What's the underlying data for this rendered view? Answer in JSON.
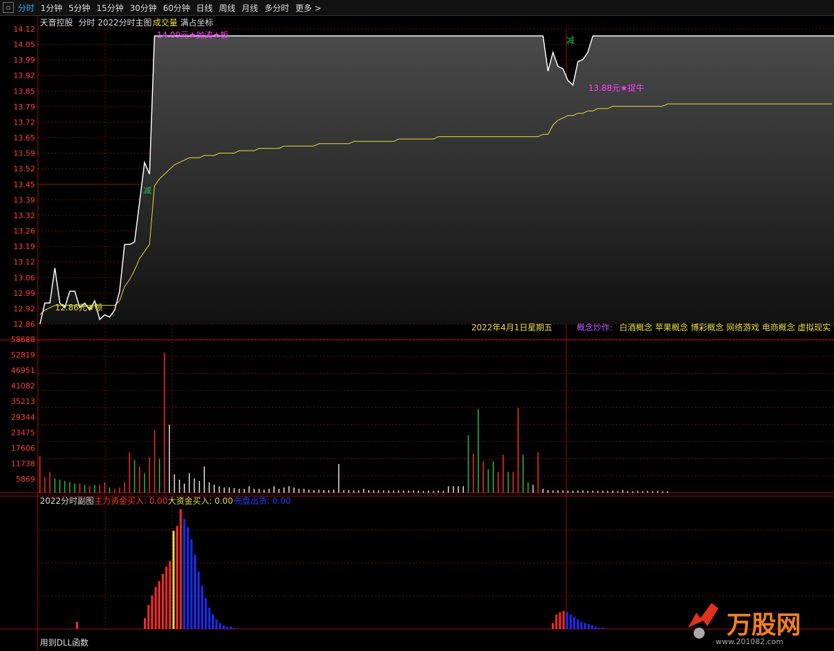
{
  "tabs": [
    {
      "label": "分时",
      "active": true
    },
    {
      "label": "1分钟"
    },
    {
      "label": "5分钟"
    },
    {
      "label": "15分钟"
    },
    {
      "label": "30分钟"
    },
    {
      "label": "60分钟"
    },
    {
      "label": "日线"
    },
    {
      "label": "周线"
    },
    {
      "label": "月线"
    },
    {
      "label": "多分时"
    },
    {
      "label": "更多 >"
    }
  ],
  "header": {
    "stock_name": "天音控股",
    "view": "分时",
    "main_chart_name": "2022分时主图",
    "volume_label": "成交量",
    "coord_label": "满占坐标"
  },
  "price_axis": [
    "14.12",
    "14.05",
    "13.99",
    "13.92",
    "13.85",
    "13.79",
    "13.72",
    "13.65",
    "13.59",
    "13.52",
    "13.45",
    "13.39",
    "13.32",
    "13.26",
    "13.19",
    "13.12",
    "13.06",
    "12.99",
    "12.92",
    "12.86"
  ],
  "volume_axis": [
    "58688",
    "52819",
    "46951",
    "41082",
    "35213",
    "29344",
    "23475",
    "17606",
    "11738",
    "5869"
  ],
  "annotations": {
    "low_marker": "12.86元★顿",
    "limit_marker": "14.09元★抛涛★板",
    "dip_marker": "13.88元★捉牛",
    "sell_mark_1": "减",
    "sell_mark_2": "减"
  },
  "date_text": "2022年4月1日星期五",
  "concept": {
    "label": "概念炒作:",
    "items": "白酒概念 苹果概念 博彩概念 网络游戏 电商概念 虚拟现实 宇"
  },
  "sub_chart": {
    "title": "2022分时副图",
    "main_in_label": "主力资金买入: 0.00",
    "big_in_label": "大资金买入: 0.00",
    "first_out_label": "先盘出货: 0.00"
  },
  "footer_text": "用到DLL函数",
  "watermark": {
    "logo_text": "万股网",
    "url": "www.201082.com"
  },
  "colors": {
    "background": "#000000",
    "price_line": "#ffffff",
    "avg_line": "#e8e03a",
    "up": "#ff2a2a",
    "down": "#23c043",
    "grid": "#7a0f0f",
    "axis_text": "#ff4040",
    "magenta": "#ff40ff",
    "blue_bar": "#1a2dff",
    "yellow_bar": "#f0e040"
  },
  "chart_data": {
    "type": "line",
    "price_ylim": [
      12.86,
      14.12
    ],
    "volume_ylim": [
      0,
      58688
    ],
    "series": [
      {
        "values": [
          12.86,
          12.95,
          12.95,
          13.1,
          12.95,
          12.93,
          13.0,
          13.0,
          12.93,
          12.95,
          12.92,
          12.96,
          12.88,
          12.9,
          12.89,
          12.92,
          13.0,
          13.2,
          13.2,
          13.21,
          13.38,
          13.55,
          13.5,
          14.09,
          14.09,
          14.09,
          14.09,
          14.09,
          14.09,
          14.09,
          14.09,
          14.09,
          14.09,
          14.09,
          14.09,
          14.09,
          14.09,
          14.09,
          14.09,
          14.09,
          14.09,
          14.09,
          14.09,
          14.09,
          14.09,
          14.09,
          14.09,
          14.09,
          14.09,
          14.09,
          14.09,
          14.09,
          14.09,
          14.09,
          14.09,
          14.09,
          14.09,
          14.09,
          14.09,
          14.09,
          14.09,
          14.09,
          14.09,
          14.09,
          14.09,
          14.09,
          14.09,
          14.09,
          14.09,
          14.09,
          14.09,
          14.09,
          14.09,
          14.09,
          14.09,
          14.09,
          14.09,
          14.09,
          14.09,
          14.09,
          14.09,
          14.09,
          14.09,
          14.09,
          14.09,
          14.09,
          14.09,
          14.09,
          14.09,
          14.09,
          14.09,
          14.09,
          14.09,
          14.09,
          14.09,
          14.09,
          14.09,
          14.09,
          14.09,
          14.09,
          14.09,
          14.09,
          13.94,
          14.02,
          13.96,
          13.95,
          13.9,
          13.88,
          13.98,
          13.99,
          14.02,
          14.09,
          14.09,
          14.09,
          14.09,
          14.09,
          14.09,
          14.09,
          14.09,
          14.09,
          14.09,
          14.09,
          14.09,
          14.09,
          14.09,
          14.09,
          14.09,
          14.09,
          14.09,
          14.09,
          14.09,
          14.09,
          14.09,
          14.09,
          14.09,
          14.09,
          14.09,
          14.09,
          14.09,
          14.09,
          14.09,
          14.09,
          14.09,
          14.09,
          14.09,
          14.09,
          14.09,
          14.09,
          14.09,
          14.09,
          14.09,
          14.09,
          14.09,
          14.09,
          14.09,
          14.09,
          14.09,
          14.09,
          14.09,
          14.09,
          14.09
        ]
      },
      {
        "values": [
          12.9,
          12.92,
          12.93,
          12.94,
          12.94,
          12.94,
          12.94,
          12.94,
          12.94,
          12.94,
          12.94,
          12.94,
          12.94,
          12.94,
          12.94,
          12.94,
          12.96,
          13.02,
          13.05,
          13.09,
          13.14,
          13.17,
          13.2,
          13.45,
          13.48,
          13.5,
          13.52,
          13.54,
          13.55,
          13.56,
          13.57,
          13.57,
          13.57,
          13.58,
          13.58,
          13.58,
          13.59,
          13.59,
          13.59,
          13.59,
          13.6,
          13.6,
          13.6,
          13.6,
          13.61,
          13.61,
          13.61,
          13.61,
          13.61,
          13.62,
          13.62,
          13.62,
          13.62,
          13.62,
          13.62,
          13.62,
          13.63,
          13.63,
          13.63,
          13.63,
          13.63,
          13.63,
          13.63,
          13.64,
          13.64,
          13.64,
          13.64,
          13.64,
          13.64,
          13.64,
          13.64,
          13.64,
          13.65,
          13.65,
          13.65,
          13.65,
          13.65,
          13.65,
          13.65,
          13.65,
          13.66,
          13.66,
          13.66,
          13.66,
          13.66,
          13.66,
          13.66,
          13.66,
          13.66,
          13.66,
          13.66,
          13.66,
          13.66,
          13.66,
          13.66,
          13.66,
          13.66,
          13.66,
          13.66,
          13.66,
          13.66,
          13.67,
          13.67,
          13.71,
          13.73,
          13.74,
          13.75,
          13.75,
          13.76,
          13.76,
          13.77,
          13.77,
          13.78,
          13.78,
          13.78,
          13.79,
          13.79,
          13.79,
          13.79,
          13.79,
          13.79,
          13.79,
          13.79,
          13.79,
          13.79,
          13.79,
          13.8,
          13.8,
          13.8,
          13.8,
          13.8,
          13.8,
          13.8,
          13.8,
          13.8,
          13.8,
          13.8,
          13.8,
          13.8,
          13.8,
          13.8,
          13.8,
          13.8,
          13.8,
          13.8,
          13.8,
          13.8,
          13.8,
          13.8,
          13.8,
          13.8,
          13.8,
          13.8,
          13.8,
          13.8,
          13.8,
          13.8,
          13.8,
          13.8,
          13.8
        ]
      }
    ],
    "volume_bars": [
      {
        "v": 14000,
        "c": "up"
      },
      {
        "v": 6000,
        "c": "up"
      },
      {
        "v": 8000,
        "c": "up"
      },
      {
        "v": 5500,
        "c": "down"
      },
      {
        "v": 5000,
        "c": "down"
      },
      {
        "v": 4500,
        "c": "down"
      },
      {
        "v": 4000,
        "c": "down"
      },
      {
        "v": 3500,
        "c": "down"
      },
      {
        "v": 3500,
        "c": "up"
      },
      {
        "v": 3000,
        "c": "down"
      },
      {
        "v": 2500,
        "c": "up"
      },
      {
        "v": 3000,
        "c": "down"
      },
      {
        "v": 3000,
        "c": "up"
      },
      {
        "v": 4000,
        "c": "up"
      },
      {
        "v": 2000,
        "c": "down"
      },
      {
        "v": 1500,
        "c": "up"
      },
      {
        "v": 2000,
        "c": "up"
      },
      {
        "v": 4000,
        "c": "up"
      },
      {
        "v": 15500,
        "c": "up"
      },
      {
        "v": 12500,
        "c": "down"
      },
      {
        "v": 10000,
        "c": "up"
      },
      {
        "v": 7500,
        "c": "down"
      },
      {
        "v": 13500,
        "c": "up"
      },
      {
        "v": 24000,
        "c": "up"
      },
      {
        "v": 13000,
        "c": "down"
      },
      {
        "v": 53500,
        "c": "up"
      },
      {
        "v": 26000,
        "c": "flat"
      },
      {
        "v": 7000,
        "c": "flat"
      },
      {
        "v": 5000,
        "c": "flat"
      },
      {
        "v": 3500,
        "c": "flat"
      },
      {
        "v": 7500,
        "c": "flat"
      },
      {
        "v": 5500,
        "c": "flat"
      },
      {
        "v": 4500,
        "c": "flat"
      },
      {
        "v": 10000,
        "c": "flat"
      },
      {
        "v": 4000,
        "c": "flat"
      },
      {
        "v": 3000,
        "c": "flat"
      },
      {
        "v": 2500,
        "c": "flat"
      },
      {
        "v": 2000,
        "c": "flat"
      },
      {
        "v": 2000,
        "c": "flat"
      },
      {
        "v": 1800,
        "c": "flat"
      },
      {
        "v": 1500,
        "c": "flat"
      },
      {
        "v": 1500,
        "c": "flat"
      },
      {
        "v": 2500,
        "c": "flat"
      },
      {
        "v": 1500,
        "c": "flat"
      },
      {
        "v": 1500,
        "c": "flat"
      },
      {
        "v": 1200,
        "c": "flat"
      },
      {
        "v": 1500,
        "c": "flat"
      },
      {
        "v": 2500,
        "c": "flat"
      },
      {
        "v": 1500,
        "c": "flat"
      },
      {
        "v": 2000,
        "c": "flat"
      },
      {
        "v": 2500,
        "c": "flat"
      },
      {
        "v": 2000,
        "c": "flat"
      },
      {
        "v": 1500,
        "c": "flat"
      },
      {
        "v": 1500,
        "c": "flat"
      },
      {
        "v": 1200,
        "c": "flat"
      },
      {
        "v": 1000,
        "c": "flat"
      },
      {
        "v": 1200,
        "c": "flat"
      },
      {
        "v": 1000,
        "c": "flat"
      },
      {
        "v": 1000,
        "c": "flat"
      },
      {
        "v": 1200,
        "c": "flat"
      },
      {
        "v": 11000,
        "c": "flat"
      },
      {
        "v": 1000,
        "c": "flat"
      },
      {
        "v": 1000,
        "c": "flat"
      },
      {
        "v": 900,
        "c": "flat"
      },
      {
        "v": 900,
        "c": "flat"
      },
      {
        "v": 1500,
        "c": "flat"
      },
      {
        "v": 1000,
        "c": "flat"
      },
      {
        "v": 900,
        "c": "flat"
      },
      {
        "v": 900,
        "c": "flat"
      },
      {
        "v": 900,
        "c": "flat"
      },
      {
        "v": 800,
        "c": "flat"
      },
      {
        "v": 800,
        "c": "flat"
      },
      {
        "v": 900,
        "c": "flat"
      },
      {
        "v": 800,
        "c": "flat"
      },
      {
        "v": 800,
        "c": "flat"
      },
      {
        "v": 900,
        "c": "flat"
      },
      {
        "v": 800,
        "c": "flat"
      },
      {
        "v": 700,
        "c": "flat"
      },
      {
        "v": 800,
        "c": "flat"
      },
      {
        "v": 700,
        "c": "flat"
      },
      {
        "v": 800,
        "c": "flat"
      },
      {
        "v": 700,
        "c": "flat"
      },
      {
        "v": 2500,
        "c": "flat"
      },
      {
        "v": 2500,
        "c": "flat"
      },
      {
        "v": 2500,
        "c": "flat"
      },
      {
        "v": 2500,
        "c": "flat"
      },
      {
        "v": 22000,
        "c": "down"
      },
      {
        "v": 15000,
        "c": "up"
      },
      {
        "v": 32000,
        "c": "down"
      },
      {
        "v": 12000,
        "c": "up"
      },
      {
        "v": 9000,
        "c": "down"
      },
      {
        "v": 12000,
        "c": "down"
      },
      {
        "v": 8000,
        "c": "up"
      },
      {
        "v": 14500,
        "c": "up"
      },
      {
        "v": 8000,
        "c": "down"
      },
      {
        "v": 8000,
        "c": "up"
      },
      {
        "v": 32500,
        "c": "up"
      },
      {
        "v": 14500,
        "c": "down"
      },
      {
        "v": 4000,
        "c": "down"
      },
      {
        "v": 3000,
        "c": "flat"
      },
      {
        "v": 15500,
        "c": "up"
      },
      {
        "v": 1500,
        "c": "flat"
      },
      {
        "v": 1000,
        "c": "flat"
      },
      {
        "v": 900,
        "c": "flat"
      },
      {
        "v": 900,
        "c": "flat"
      },
      {
        "v": 900,
        "c": "flat"
      },
      {
        "v": 800,
        "c": "flat"
      },
      {
        "v": 800,
        "c": "flat"
      },
      {
        "v": 800,
        "c": "flat"
      },
      {
        "v": 900,
        "c": "flat"
      },
      {
        "v": 700,
        "c": "flat"
      },
      {
        "v": 800,
        "c": "flat"
      },
      {
        "v": 700,
        "c": "flat"
      },
      {
        "v": 800,
        "c": "flat"
      },
      {
        "v": 700,
        "c": "flat"
      },
      {
        "v": 800,
        "c": "flat"
      },
      {
        "v": 700,
        "c": "flat"
      },
      {
        "v": 1000,
        "c": "flat"
      },
      {
        "v": 700,
        "c": "flat"
      },
      {
        "v": 600,
        "c": "flat"
      },
      {
        "v": 700,
        "c": "flat"
      },
      {
        "v": 600,
        "c": "flat"
      },
      {
        "v": 700,
        "c": "flat"
      },
      {
        "v": 600,
        "c": "flat"
      },
      {
        "v": 700,
        "c": "flat"
      },
      {
        "v": 600,
        "c": "flat"
      },
      {
        "v": 600,
        "c": "flat"
      }
    ],
    "sub_bars": [
      {
        "i": 9,
        "h": 0.06,
        "c": "red"
      },
      {
        "i": 28,
        "h": 0.09,
        "c": "red"
      },
      {
        "i": 29,
        "h": 0.2,
        "c": "red"
      },
      {
        "i": 30,
        "h": 0.28,
        "c": "red"
      },
      {
        "i": 31,
        "h": 0.35,
        "c": "red"
      },
      {
        "i": 32,
        "h": 0.4,
        "c": "red"
      },
      {
        "i": 33,
        "h": 0.46,
        "c": "red"
      },
      {
        "i": 34,
        "h": 0.52,
        "c": "red"
      },
      {
        "i": 35,
        "h": 0.57,
        "c": "red"
      },
      {
        "i": 36,
        "h": 0.82,
        "c": "yellow"
      },
      {
        "i": 37,
        "h": 0.86,
        "c": "red"
      },
      {
        "i": 38,
        "h": 1.0,
        "c": "red"
      },
      {
        "i": 39,
        "h": 0.92,
        "c": "blue"
      },
      {
        "i": 40,
        "h": 0.85,
        "c": "blue"
      },
      {
        "i": 41,
        "h": 0.75,
        "c": "blue"
      },
      {
        "i": 42,
        "h": 0.62,
        "c": "blue"
      },
      {
        "i": 43,
        "h": 0.48,
        "c": "blue"
      },
      {
        "i": 44,
        "h": 0.36,
        "c": "blue"
      },
      {
        "i": 45,
        "h": 0.26,
        "c": "blue"
      },
      {
        "i": 46,
        "h": 0.18,
        "c": "blue"
      },
      {
        "i": 47,
        "h": 0.12,
        "c": "blue"
      },
      {
        "i": 48,
        "h": 0.08,
        "c": "blue"
      },
      {
        "i": 49,
        "h": 0.05,
        "c": "blue"
      },
      {
        "i": 50,
        "h": 0.03,
        "c": "blue"
      },
      {
        "i": 51,
        "h": 0.02,
        "c": "blue"
      },
      {
        "i": 52,
        "h": 0.02,
        "c": "blue"
      },
      {
        "i": 53,
        "h": 0.01,
        "c": "blue"
      },
      {
        "i": 142,
        "h": 0.05,
        "c": "red"
      },
      {
        "i": 143,
        "h": 0.12,
        "c": "red"
      },
      {
        "i": 144,
        "h": 0.14,
        "c": "red"
      },
      {
        "i": 145,
        "h": 0.15,
        "c": "red"
      },
      {
        "i": 146,
        "h": 0.14,
        "c": "blue"
      },
      {
        "i": 147,
        "h": 0.12,
        "c": "blue"
      },
      {
        "i": 148,
        "h": 0.1,
        "c": "blue"
      },
      {
        "i": 149,
        "h": 0.08,
        "c": "blue"
      },
      {
        "i": 150,
        "h": 0.06,
        "c": "blue"
      },
      {
        "i": 151,
        "h": 0.05,
        "c": "blue"
      },
      {
        "i": 152,
        "h": 0.04,
        "c": "blue"
      },
      {
        "i": 153,
        "h": 0.03,
        "c": "blue"
      },
      {
        "i": 154,
        "h": 0.02,
        "c": "blue"
      },
      {
        "i": 155,
        "h": 0.01,
        "c": "blue"
      },
      {
        "i": 156,
        "h": 0.01,
        "c": "blue"
      }
    ]
  }
}
